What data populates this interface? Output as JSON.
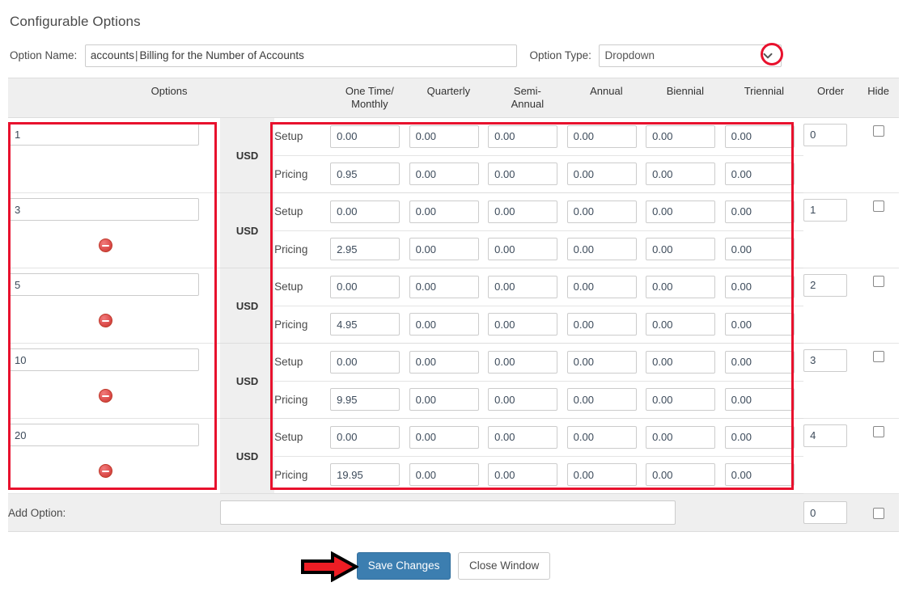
{
  "page": {
    "title": "Configurable Options"
  },
  "form": {
    "option_name_label": "Option Name:",
    "option_name_key": "accounts",
    "option_name_separator": "|",
    "option_name_description": "Billing for the Number of Accounts",
    "option_type_label": "Option Type:",
    "option_type_value": "Dropdown",
    "option_type_icon": "chevron-down-icon"
  },
  "table": {
    "headers": {
      "options": "Options",
      "one_time_monthly": "One Time/ Monthly",
      "one_time_monthly_line1": "One Time/",
      "one_time_monthly_line2": "Monthly",
      "quarterly": "Quarterly",
      "semi_annual_line1": "Semi-",
      "semi_annual_line2": "Annual",
      "annual": "Annual",
      "biennial": "Biennial",
      "triennial": "Triennial",
      "order": "Order",
      "hide": "Hide"
    },
    "row_type_labels": {
      "setup": "Setup",
      "pricing": "Pricing"
    },
    "currency": "USD",
    "rows": [
      {
        "option": "1",
        "currency": "USD",
        "order": "0",
        "hide": false,
        "deletable": false,
        "setup": [
          "0.00",
          "0.00",
          "0.00",
          "0.00",
          "0.00",
          "0.00"
        ],
        "pricing": [
          "0.95",
          "0.00",
          "0.00",
          "0.00",
          "0.00",
          "0.00"
        ]
      },
      {
        "option": "3",
        "currency": "USD",
        "order": "1",
        "hide": false,
        "deletable": true,
        "setup": [
          "0.00",
          "0.00",
          "0.00",
          "0.00",
          "0.00",
          "0.00"
        ],
        "pricing": [
          "2.95",
          "0.00",
          "0.00",
          "0.00",
          "0.00",
          "0.00"
        ]
      },
      {
        "option": "5",
        "currency": "USD",
        "order": "2",
        "hide": false,
        "deletable": true,
        "setup": [
          "0.00",
          "0.00",
          "0.00",
          "0.00",
          "0.00",
          "0.00"
        ],
        "pricing": [
          "4.95",
          "0.00",
          "0.00",
          "0.00",
          "0.00",
          "0.00"
        ]
      },
      {
        "option": "10",
        "currency": "USD",
        "order": "3",
        "hide": false,
        "deletable": true,
        "setup": [
          "0.00",
          "0.00",
          "0.00",
          "0.00",
          "0.00",
          "0.00"
        ],
        "pricing": [
          "9.95",
          "0.00",
          "0.00",
          "0.00",
          "0.00",
          "0.00"
        ]
      },
      {
        "option": "20",
        "currency": "USD",
        "order": "4",
        "hide": false,
        "deletable": true,
        "setup": [
          "0.00",
          "0.00",
          "0.00",
          "0.00",
          "0.00",
          "0.00"
        ],
        "pricing": [
          "19.95",
          "0.00",
          "0.00",
          "0.00",
          "0.00",
          "0.00"
        ]
      }
    ],
    "add_row": {
      "label": "Add Option:",
      "value": "",
      "order": "0",
      "hide": false
    }
  },
  "buttons": {
    "save": "Save Changes",
    "close": "Close Window"
  },
  "annotations": {
    "accent_color": "#e8112d",
    "arrow_name": "right-arrow-annotation",
    "highlight_options": "options-column-highlight",
    "highlight_pricing": "pricing-grid-highlight",
    "ring_dropdown": "option-type-dropdown-highlight"
  }
}
